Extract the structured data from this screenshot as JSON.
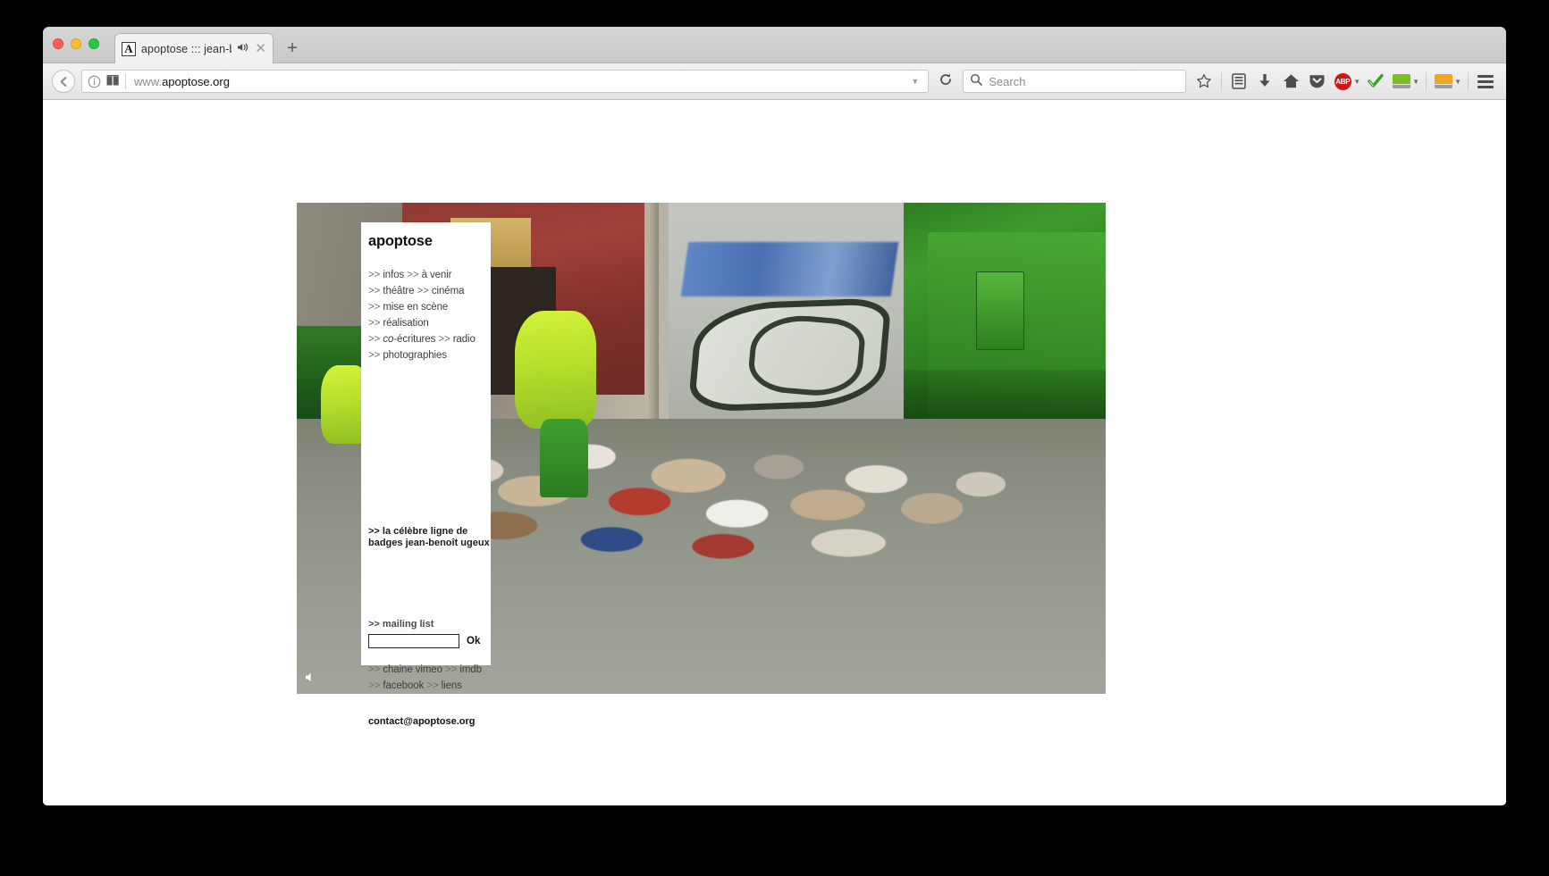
{
  "browser": {
    "tab": {
      "title": "apoptose ::: jean-benoî...",
      "favicon_letter": "A",
      "favicon_icon": "apoptose-favicon",
      "sound_icon": "speaker-playing-icon",
      "close_icon": "close-icon"
    },
    "new_tab_label": "+",
    "back_icon": "back-arrow-icon",
    "url": {
      "scheme_prefix": "www.",
      "domain": "apoptose.org",
      "full": "www.apoptose.org",
      "info_icon": "page-info-icon",
      "reader_icon": "reader-view-icon",
      "dropdown_icon": "chevron-down-icon",
      "reload_icon": "reload-icon"
    },
    "search": {
      "placeholder": "Search",
      "icon": "search-icon"
    },
    "toolbar_icons": [
      {
        "name": "bookmark-star-icon",
        "label": ""
      },
      {
        "name": "library-icon",
        "label": ""
      },
      {
        "name": "downloads-icon",
        "label": ""
      },
      {
        "name": "home-icon",
        "label": ""
      },
      {
        "name": "pocket-icon",
        "label": ""
      },
      {
        "name": "adblock-plus-icon",
        "label": "ABP"
      },
      {
        "name": "checkmark-addon-icon",
        "label": ""
      },
      {
        "name": "green-book-addon-icon",
        "label": ""
      },
      {
        "name": "orange-book-addon-icon",
        "label": ""
      },
      {
        "name": "hamburger-menu-icon",
        "label": ""
      }
    ],
    "window_controls": {
      "close": "close-window-button",
      "minimize": "minimize-window-button",
      "zoom": "zoom-window-button"
    },
    "colors": {
      "accent_red": "#ff5f57",
      "accent_yellow": "#ffbd2e",
      "accent_green": "#28c940",
      "abp_red": "#d11313",
      "addon_green": "#7bbd24",
      "addon_orange": "#f2a424"
    }
  },
  "site": {
    "logo": "apoptose",
    "nav": [
      {
        "arrows": ">>",
        "label": "infos",
        "italic_prefix": ""
      },
      {
        "arrows": ">>",
        "label": "à venir",
        "italic_prefix": ""
      },
      {
        "arrows": ">>",
        "label": "théâtre",
        "italic_prefix": ""
      },
      {
        "arrows": ">>",
        "label": "cinéma",
        "italic_prefix": ""
      },
      {
        "arrows": ">>",
        "label": "mise en scène",
        "italic_prefix": ""
      },
      {
        "arrows": ">>",
        "label": "réalisation",
        "italic_prefix": ""
      },
      {
        "arrows": ">>",
        "label": "-écritures",
        "italic_prefix": "co"
      },
      {
        "arrows": ">>",
        "label": "radio",
        "italic_prefix": ""
      },
      {
        "arrows": ">>",
        "label": "photographies",
        "italic_prefix": ""
      }
    ],
    "badges": {
      "line1": ">> la célèbre ligne de",
      "line2": "badges jean-benoît ugeux"
    },
    "mailing": {
      "label": ">> mailing list",
      "value": "",
      "placeholder": "",
      "submit_label": "Ok"
    },
    "social": [
      {
        "arrows": ">>",
        "label": "chaine vimeo"
      },
      {
        "arrows": ">>",
        "label": "imdb"
      },
      {
        "arrows": ">>",
        "label": "facebook"
      },
      {
        "arrows": ">>",
        "label": "liens"
      }
    ],
    "contact_email": "contact@apoptose.org",
    "video": {
      "mute_icon": "speaker-mute-icon",
      "description": "street scene with waste collectors in hi-vis vests, green garbage truck and graffiti wall"
    }
  }
}
